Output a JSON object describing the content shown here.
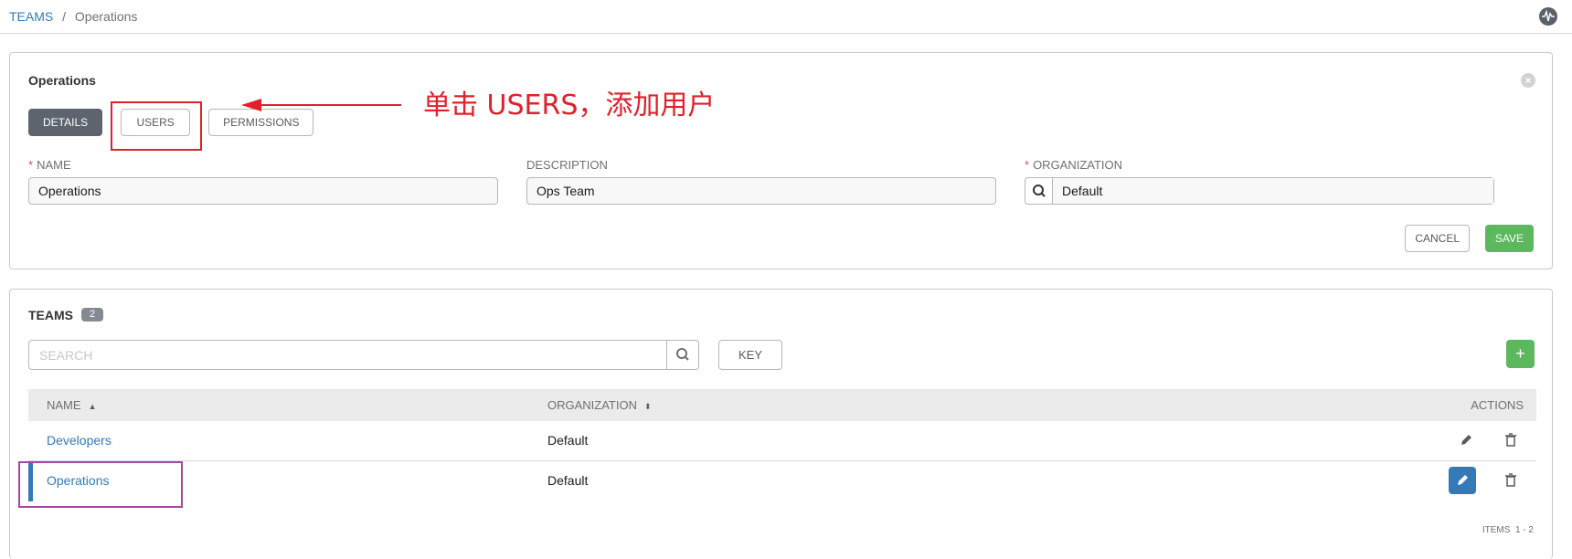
{
  "breadcrumb": {
    "root": "TEAMS",
    "separator": "/",
    "current": "Operations"
  },
  "header": {
    "activity_icon": "activity-stream-icon"
  },
  "form": {
    "title": "Operations",
    "tabs": [
      {
        "label": "DETAILS",
        "active": true
      },
      {
        "label": "USERS",
        "active": false
      },
      {
        "label": "PERMISSIONS",
        "active": false
      }
    ],
    "annotation": "单击 USERS，添加用户",
    "fields": {
      "name": {
        "label": "NAME",
        "required": true,
        "value": "Operations"
      },
      "description": {
        "label": "DESCRIPTION",
        "required": false,
        "value": "Ops Team"
      },
      "organization": {
        "label": "ORGANIZATION",
        "required": true,
        "value": "Default"
      }
    },
    "buttons": {
      "cancel": "CANCEL",
      "save": "SAVE"
    }
  },
  "teams": {
    "title": "TEAMS",
    "count": "2",
    "search_placeholder": "SEARCH",
    "key_label": "KEY",
    "add_label": "+",
    "columns": {
      "name": "NAME",
      "organization": "ORGANIZATION",
      "actions": "ACTIONS"
    },
    "rows": [
      {
        "name": "Developers",
        "organization": "Default",
        "selected": false
      },
      {
        "name": "Operations",
        "organization": "Default",
        "selected": true
      }
    ],
    "pager_label": "ITEMS",
    "pager_range": "1 - 2"
  },
  "colors": {
    "link": "#337ab7",
    "success": "#5cb85c",
    "annotation_red": "#e0202b",
    "annotation_purple": "#a349a4"
  }
}
